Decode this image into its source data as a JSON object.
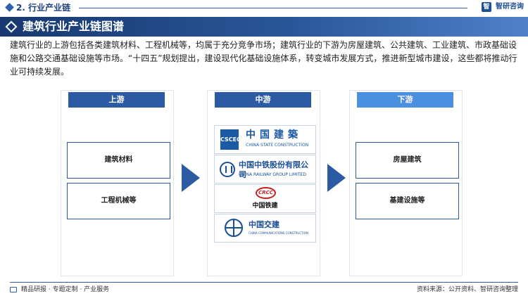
{
  "header": {
    "section_label": "2. 行业产业链",
    "brand_name": "智研咨询",
    "brand_icon": "zhiyan-logo-icon"
  },
  "title": "建筑行业产业链图谱",
  "intro": "建筑行业的上游包括各类建筑材料、工程机械等，均属于充分竞争市场；建筑行业的下游为房屋建筑、公共建筑、工业建筑、市政基础设施和公路交通基础设施等市场。“十四五”规划提出，建设现代化基础设施体系，转变城市发展方式，推进新型城市建设，这些都将推动行业可持续发展。",
  "chain": {
    "upstream": {
      "label": "上游",
      "items": [
        "建筑材料",
        "工程机械等"
      ]
    },
    "midstream": {
      "label": "中游",
      "logos": [
        {
          "cn": "中国建築",
          "en": "CHINA STATE CONSTRUCTION",
          "mark": "CSCEC"
        },
        {
          "cn": "中国中铁股份有限公司",
          "en": "CHINA RAILWAY GROUP LIMITED"
        },
        {
          "cn": "中国铁建",
          "mark": "CRCC"
        },
        {
          "cn": "中国交建",
          "en": "CHINA COMMUNICATIONS CONSTRUCTION"
        }
      ]
    },
    "downstream": {
      "label": "下游",
      "items": [
        "房屋建筑",
        "基建设施等"
      ]
    }
  },
  "colors": {
    "primary": "#2d5ba3",
    "downstream_header": "#4a8fe0",
    "title_band_start": "#18396f",
    "title_band_end": "#4f80c9"
  },
  "footer": {
    "left": "精品研报 · 专题定制 · 产业服务",
    "right": "资料来源：公开资料、智研咨询整理"
  }
}
